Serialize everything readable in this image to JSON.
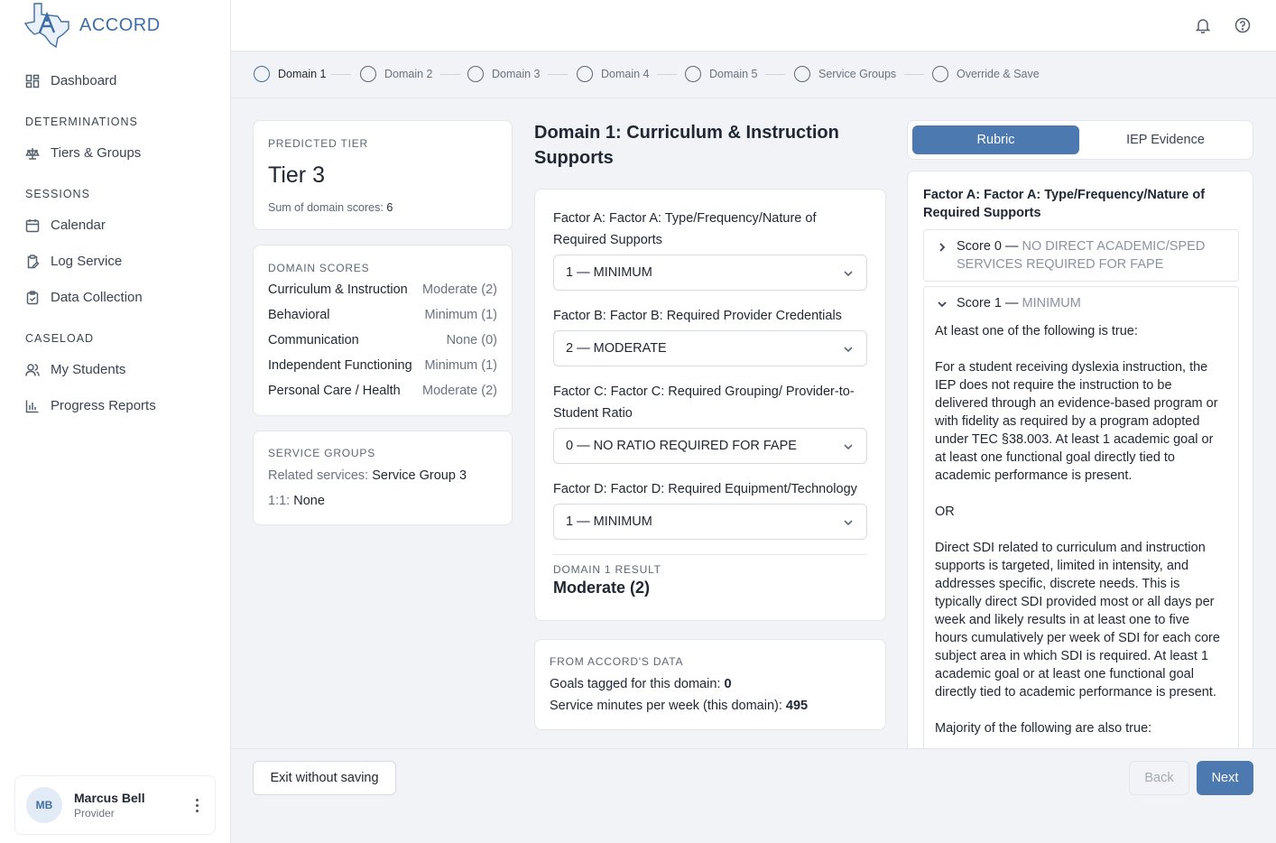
{
  "app": {
    "name": "ACCORD"
  },
  "sidebar": {
    "dashboard": "Dashboard",
    "sections": {
      "determinations": "DETERMINATIONS",
      "sessions": "SESSIONS",
      "caseload": "CASELOAD"
    },
    "items": {
      "tiers_groups": "Tiers & Groups",
      "calendar": "Calendar",
      "log_service": "Log Service",
      "data_collection": "Data Collection",
      "my_students": "My Students",
      "progress_reports": "Progress Reports"
    },
    "user": {
      "initials": "MB",
      "name": "Marcus Bell",
      "role": "Provider"
    }
  },
  "stepper": [
    "Domain 1",
    "Domain 2",
    "Domain 3",
    "Domain 4",
    "Domain 5",
    "Service Groups",
    "Override & Save"
  ],
  "predicted": {
    "label": "PREDICTED TIER",
    "tier": "Tier 3",
    "sum_label": "Sum of domain scores:",
    "sum_value": "6"
  },
  "domain_scores": {
    "label": "DOMAIN SCORES",
    "rows": [
      {
        "name": "Curriculum & Instruction",
        "value": "Moderate (2)"
      },
      {
        "name": "Behavioral",
        "value": "Minimum (1)"
      },
      {
        "name": "Communication",
        "value": "None (0)"
      },
      {
        "name": "Independent Functioning",
        "value": "Minimum (1)"
      },
      {
        "name": "Personal Care / Health",
        "value": "Moderate (2)"
      }
    ]
  },
  "service_groups": {
    "label": "SERVICE GROUPS",
    "related_label": "Related services:",
    "related_value": "Service Group 3",
    "one_label": "1:1:",
    "one_value": "None"
  },
  "domain": {
    "title": "Domain 1: Curriculum & Instruction Supports",
    "factors": [
      {
        "label": "Factor A: Factor A: Type/Frequency/Nature of Required Supports",
        "value": "1 — MINIMUM"
      },
      {
        "label": "Factor B: Factor B: Required Provider Credentials",
        "value": "2 — MODERATE"
      },
      {
        "label": "Factor C: Factor C: Required Grouping/ Provider-to-Student Ratio",
        "value": "0 — NO RATIO REQUIRED FOR FAPE"
      },
      {
        "label": "Factor D: Factor D: Required Equipment/Technology",
        "value": "1 — MINIMUM"
      }
    ],
    "result_label": "DOMAIN 1 RESULT",
    "result_value": "Moderate (2)"
  },
  "accord_data": {
    "label": "FROM ACCORD'S DATA",
    "goals_label": "Goals tagged for this domain:",
    "goals_value": "0",
    "minutes_label": "Service minutes per week (this domain):",
    "minutes_value": "495"
  },
  "tabs": {
    "rubric": "Rubric",
    "iep": "IEP Evidence"
  },
  "rubric": {
    "title": "Factor A: Factor A: Type/Frequency/Nature of Required Supports",
    "score0_prefix": "Score 0 —",
    "score0_text": "NO DIRECT ACADEMIC/SPED SERVICES REQUIRED FOR FAPE",
    "score1_prefix": "Score 1 —",
    "score1_text": "MINIMUM",
    "p1": "At least one of the following is true:",
    "p2": "For a student receiving dyslexia instruction, the IEP does not require the instruction to be delivered through an evidence-based program or with fidelity as required by a program adopted under TEC §38.003. At least 1 academic goal or at least one functional goal directly tied to academic performance is present.",
    "p3": "OR",
    "p4": "Direct SDI related to curriculum and instruction supports is targeted, limited in intensity, and addresses specific, discrete needs. This is typically direct SDI provided most or all days per week and likely results in at least one to five hours cumulatively per week of SDI for each core subject area in which SDI is required. At least 1 academic goal or at least one functional goal directly tied to academic performance is present.",
    "p5": "Majority of the following are also true:"
  },
  "footer": {
    "exit": "Exit without saving",
    "back": "Back",
    "next": "Next"
  },
  "colors": {
    "accent": "#4c79b0",
    "brand": "#3f6ea6"
  }
}
